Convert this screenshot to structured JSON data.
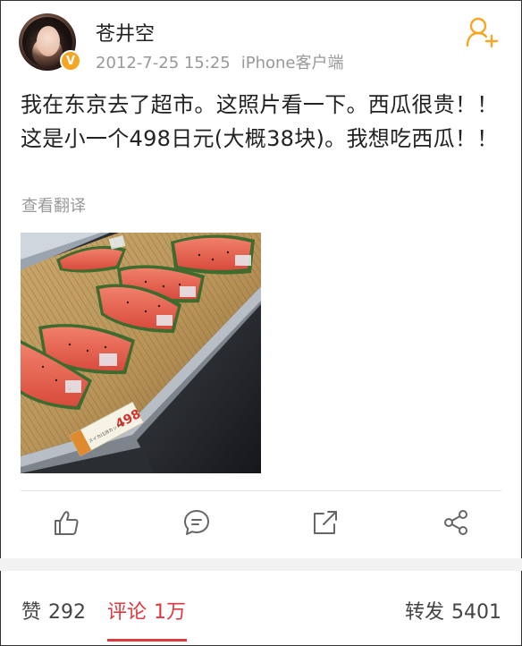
{
  "post": {
    "username": "苍井空",
    "timestamp": "2012-7-25 15:25",
    "source": "iPhone客户端",
    "verified_badge": "V",
    "text": "我在东京去了超市。这照片看一下。西瓜很贵！！ 这是小一个498日元(大概38块)。我想吃西瓜！！",
    "translate_link": "查看翻译",
    "photo": {
      "tag_price": "498",
      "tag_label": "スイカ(1/8カット)"
    }
  },
  "actions": [
    {
      "name": "like",
      "icon": "thumbs-up-icon"
    },
    {
      "name": "comment",
      "icon": "comment-bubble-icon"
    },
    {
      "name": "repost",
      "icon": "share-out-icon"
    },
    {
      "name": "share",
      "icon": "share-nodes-icon"
    }
  ],
  "stats": {
    "likes_label": "赞",
    "likes_count": "292",
    "comments_label": "评论",
    "comments_count": "1万",
    "reposts_label": "转发",
    "reposts_count": "5401"
  },
  "colors": {
    "accent": "#e0383e",
    "follow": "#f5a623",
    "muted_text": "#999999"
  }
}
